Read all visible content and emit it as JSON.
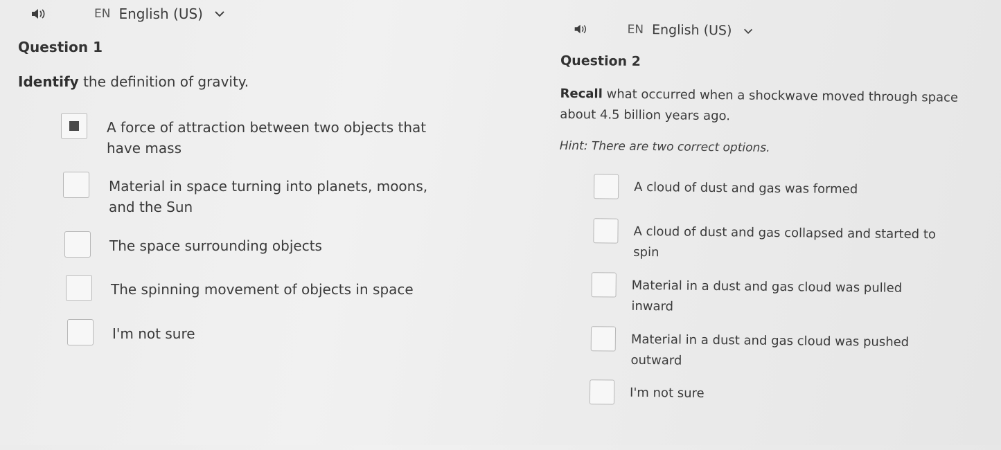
{
  "question1": {
    "language": {
      "code": "EN",
      "label": "English (US)"
    },
    "number": "Question 1",
    "prompt_bold": "Identify",
    "prompt_rest": " the definition of gravity.",
    "options": [
      {
        "text": "A force of attraction between two objects that have mass",
        "selected": true
      },
      {
        "text": "Material in space turning into planets, moons, and the Sun",
        "selected": false
      },
      {
        "text": "The space surrounding objects",
        "selected": false
      },
      {
        "text": "The spinning movement of objects in space",
        "selected": false
      },
      {
        "text": "I'm not sure",
        "selected": false
      }
    ]
  },
  "question2": {
    "language": {
      "code": "EN",
      "label": "English (US)"
    },
    "number": "Question 2",
    "prompt_bold": "Recall",
    "prompt_rest": " what occurred when a shockwave moved through space about 4.5 billion years ago.",
    "hint": "Hint: There are two correct options.",
    "options": [
      {
        "text": "A cloud of dust and gas was formed",
        "selected": false
      },
      {
        "text": "A cloud of dust and gas collapsed and started to spin",
        "selected": false
      },
      {
        "text": "Material in a dust and gas cloud was pulled inward",
        "selected": false
      },
      {
        "text": "Material in a dust and gas cloud was pushed outward",
        "selected": false
      },
      {
        "text": "I'm not sure",
        "selected": false
      }
    ]
  }
}
